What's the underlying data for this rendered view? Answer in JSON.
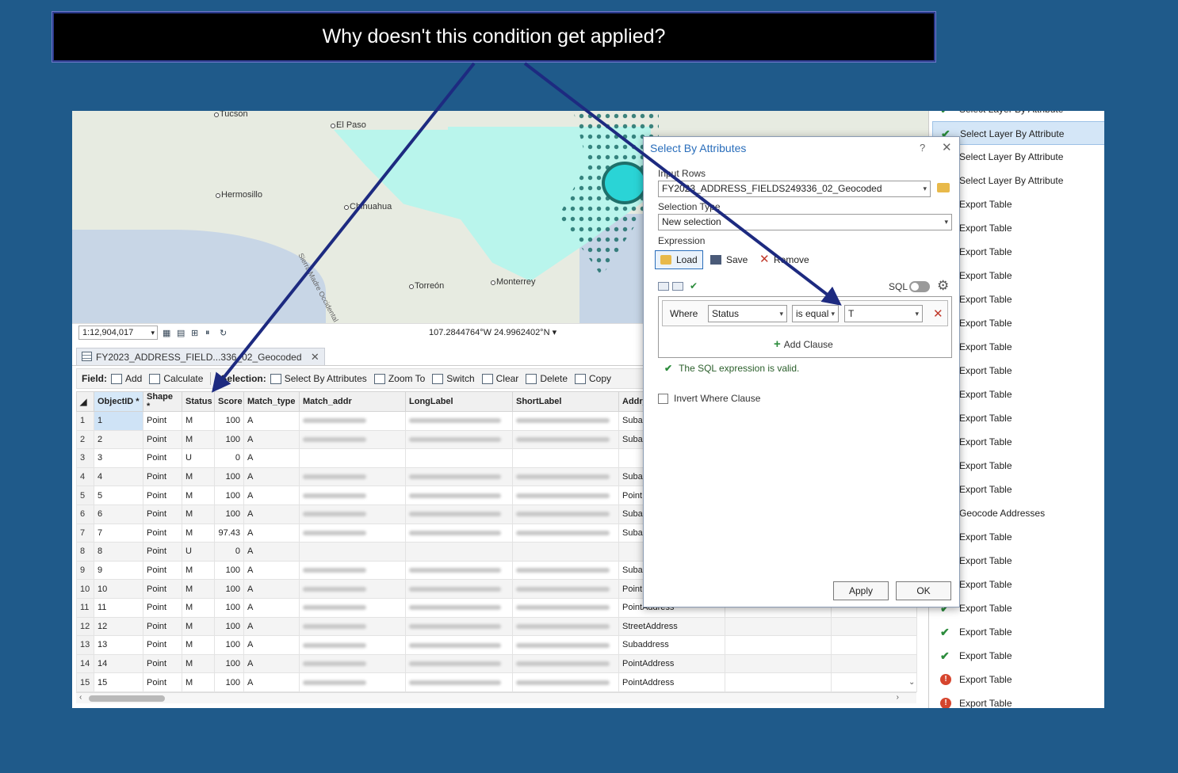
{
  "banner": {
    "text": "Why doesn't this condition get applied?"
  },
  "map": {
    "labels": {
      "tucson": "Tucson",
      "elpaso": "El Paso",
      "hermosillo": "Hermosillo",
      "chihuahua": "Chihuahua",
      "torreon": "Torreón",
      "monterrey": "Monterrey",
      "sierra": "Sierra Madre Occidental"
    },
    "scale": "1:12,904,017",
    "coords": "107.2844764°W 24.9962402°N"
  },
  "table": {
    "tab_label": "FY2023_ADDRESS_FIELD...336_02_Geocoded",
    "toolbar": {
      "field_label": "Field:",
      "add": "Add",
      "calculate": "Calculate",
      "selection_label": "Selection:",
      "select_by_attributes": "Select By Attributes",
      "zoom_to": "Zoom To",
      "switch": "Switch",
      "clear": "Clear",
      "delete": "Delete",
      "copy": "Copy"
    },
    "columns": [
      "ObjectID *",
      "Shape *",
      "Status",
      "Score",
      "Match_type",
      "Match_addr",
      "LongLabel",
      "ShortLabel",
      "Addr_type"
    ],
    "rows": [
      {
        "n": "1",
        "id": "1",
        "shape": "Point",
        "status": "M",
        "score": "100",
        "match": "A",
        "addr": "Suba"
      },
      {
        "n": "2",
        "id": "2",
        "shape": "Point",
        "status": "M",
        "score": "100",
        "match": "A",
        "addr": "Suba"
      },
      {
        "n": "3",
        "id": "3",
        "shape": "Point",
        "status": "U",
        "score": "0",
        "match": "A",
        "addr": ""
      },
      {
        "n": "4",
        "id": "4",
        "shape": "Point",
        "status": "M",
        "score": "100",
        "match": "A",
        "addr": "Suba"
      },
      {
        "n": "5",
        "id": "5",
        "shape": "Point",
        "status": "M",
        "score": "100",
        "match": "A",
        "addr": "Point"
      },
      {
        "n": "6",
        "id": "6",
        "shape": "Point",
        "status": "M",
        "score": "100",
        "match": "A",
        "addr": "Suba"
      },
      {
        "n": "7",
        "id": "7",
        "shape": "Point",
        "status": "M",
        "score": "97.43",
        "match": "A",
        "addr": "Suba"
      },
      {
        "n": "8",
        "id": "8",
        "shape": "Point",
        "status": "U",
        "score": "0",
        "match": "A",
        "addr": ""
      },
      {
        "n": "9",
        "id": "9",
        "shape": "Point",
        "status": "M",
        "score": "100",
        "match": "A",
        "addr": "Suba"
      },
      {
        "n": "10",
        "id": "10",
        "shape": "Point",
        "status": "M",
        "score": "100",
        "match": "A",
        "addr": "Point"
      },
      {
        "n": "11",
        "id": "11",
        "shape": "Point",
        "status": "M",
        "score": "100",
        "match": "A",
        "addr": "PointAddress"
      },
      {
        "n": "12",
        "id": "12",
        "shape": "Point",
        "status": "M",
        "score": "100",
        "match": "A",
        "addr": "StreetAddress"
      },
      {
        "n": "13",
        "id": "13",
        "shape": "Point",
        "status": "M",
        "score": "100",
        "match": "A",
        "addr": "Subaddress"
      },
      {
        "n": "14",
        "id": "14",
        "shape": "Point",
        "status": "M",
        "score": "100",
        "match": "A",
        "addr": "PointAddress"
      },
      {
        "n": "15",
        "id": "15",
        "shape": "Point",
        "status": "M",
        "score": "100",
        "match": "A",
        "addr": "PointAddress"
      }
    ]
  },
  "dialog": {
    "title": "Select By Attributes",
    "help": "?",
    "close": "✕",
    "input_rows_label": "Input Rows",
    "input_rows_value": "FY2023_ADDRESS_FIELDS249336_02_Geocoded",
    "selection_type_label": "Selection Type",
    "selection_type_value": "New selection",
    "expression_label": "Expression",
    "load": "Load",
    "save": "Save",
    "remove": "Remove",
    "sql_label": "SQL",
    "where_label": "Where",
    "field_value": "Status",
    "operator_value": "is equal",
    "value_value": "T",
    "add_clause": "Add Clause",
    "valid_msg": "The SQL expression is valid.",
    "invert_label": "Invert Where Clause",
    "apply": "Apply",
    "ok": "OK"
  },
  "history": {
    "items": [
      {
        "label": "Select Layer By Attribute",
        "status": "ok"
      },
      {
        "label": "Select Layer By Attribute",
        "status": "ok",
        "selected": true
      },
      {
        "label": "Select Layer By Attribute",
        "status": "ok"
      },
      {
        "label": "Select Layer By Attribute",
        "status": "ok"
      },
      {
        "label": "Export Table",
        "status": "ok"
      },
      {
        "label": "Export Table",
        "status": "ok"
      },
      {
        "label": "Export Table",
        "status": "ok"
      },
      {
        "label": "Export Table",
        "status": "ok"
      },
      {
        "label": "Export Table",
        "status": "ok"
      },
      {
        "label": "Export Table",
        "status": "ok"
      },
      {
        "label": "Export Table",
        "status": "ok"
      },
      {
        "label": "Export Table",
        "status": "ok"
      },
      {
        "label": "Export Table",
        "status": "ok"
      },
      {
        "label": "Export Table",
        "status": "ok"
      },
      {
        "label": "Export Table",
        "status": "ok"
      },
      {
        "label": "Export Table",
        "status": "ok"
      },
      {
        "label": "Export Table",
        "status": "ok"
      },
      {
        "label": "Geocode Addresses",
        "status": "ok"
      },
      {
        "label": "Export Table",
        "status": "ok"
      },
      {
        "label": "Export Table",
        "status": "ok"
      },
      {
        "label": "Export Table",
        "status": "ok"
      },
      {
        "label": "Export Table",
        "status": "ok"
      },
      {
        "label": "Export Table",
        "status": "ok"
      },
      {
        "label": "Export Table",
        "status": "ok"
      },
      {
        "label": "Export Table",
        "status": "error"
      },
      {
        "label": "Export Table",
        "status": "error"
      }
    ]
  },
  "colors": {
    "accent": "#2a6ebb",
    "success": "#2c8c3c",
    "error": "#d6452e",
    "background": "#1f5a8a",
    "arrow": "#1d2a80"
  }
}
